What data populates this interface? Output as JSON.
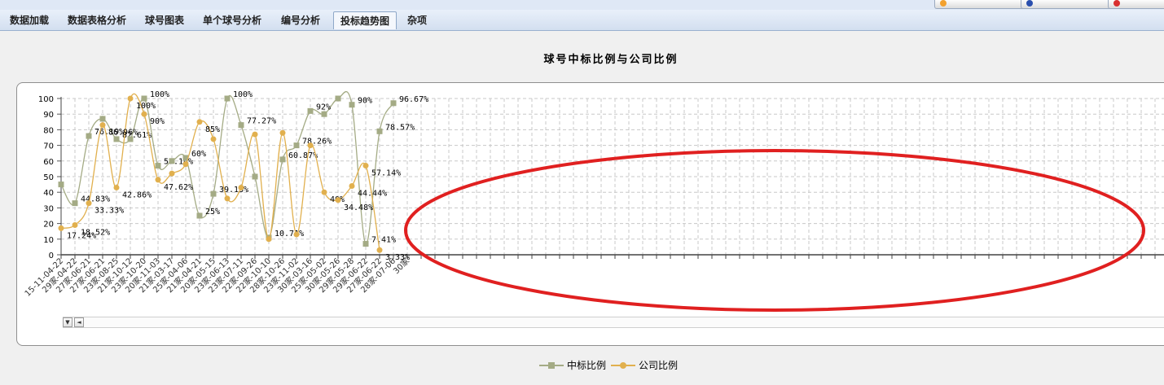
{
  "tabs": [
    {
      "label": "数据加载",
      "active": false
    },
    {
      "label": "数据表格分析",
      "active": false
    },
    {
      "label": "球号图表",
      "active": false
    },
    {
      "label": "单个球号分析",
      "active": false
    },
    {
      "label": "编号分析",
      "active": false
    },
    {
      "label": "投标趋势图",
      "active": true
    },
    {
      "label": "杂项",
      "active": false
    }
  ],
  "colors": {
    "series1": "#a4ab85",
    "series2": "#e1b04e",
    "annotation_ellipse": "#e02020",
    "grid": "#c8c8c8"
  },
  "chart_data": {
    "type": "line",
    "title": "球号中标比例与公司比例",
    "xlabel": "",
    "ylabel": "",
    "ylim": [
      0,
      100
    ],
    "yticks": [
      0,
      10,
      20,
      30,
      40,
      50,
      60,
      70,
      80,
      90,
      100
    ],
    "grid": true,
    "legend_position": "bottom-center",
    "categories": [
      "15-11-04-22",
      "29家-04-22",
      "27家-06-21",
      "27家-06-21",
      "23家-08-25",
      "21家-10-12",
      "23家-10-20",
      "20家-11-03",
      "21家-03-17",
      "25家-04-06",
      "21家-04-21",
      "20家-05-15",
      "23家-06-13",
      "23家-07-11",
      "22家-09-26",
      "22家-10-10",
      "28家-10-26",
      "23家-11-02",
      "30家-03-16",
      "25家-05-02",
      "30家-05-26",
      "29家-05-28",
      "29家-06-22",
      "27家-06-22",
      "28家-07-06",
      "30家"
    ],
    "series": [
      {
        "name": "中标比例",
        "values": [
          45,
          33,
          76,
          87,
          74,
          74,
          100,
          57,
          60,
          62,
          25,
          39,
          100,
          83,
          50,
          11,
          61,
          70,
          92,
          90,
          100,
          96,
          7,
          79,
          97,
          null
        ],
        "labels": [
          "",
          "44.83%",
          "76.19%",
          "",
          "82.61%",
          "",
          "100%",
          "57.14%",
          "",
          "60%",
          "25%",
          "39.13%",
          "100%",
          "77.27%",
          "",
          "10.71%",
          "60.87%",
          "78.26%",
          "92%",
          "",
          "",
          "90%",
          "7.41%",
          "78.57%",
          "96.67%",
          ""
        ]
      },
      {
        "name": "公司比例",
        "values": [
          17,
          19,
          33,
          83,
          43,
          100,
          90,
          48,
          52,
          58,
          85,
          74,
          36,
          43,
          77,
          10,
          78,
          13,
          70,
          40,
          35,
          44,
          57,
          3,
          null,
          null
        ],
        "labels": [
          "17.24%",
          "18.52%",
          "33.33%",
          "86.96%",
          "42.86%",
          "100%",
          "90%",
          "47.62%",
          "",
          "",
          "85%",
          "",
          "",
          "",
          "",
          "",
          "",
          "",
          "",
          "40%",
          "34.48%",
          "44.44%",
          "57.14%",
          "3.33%",
          "",
          ""
        ]
      }
    ]
  }
}
